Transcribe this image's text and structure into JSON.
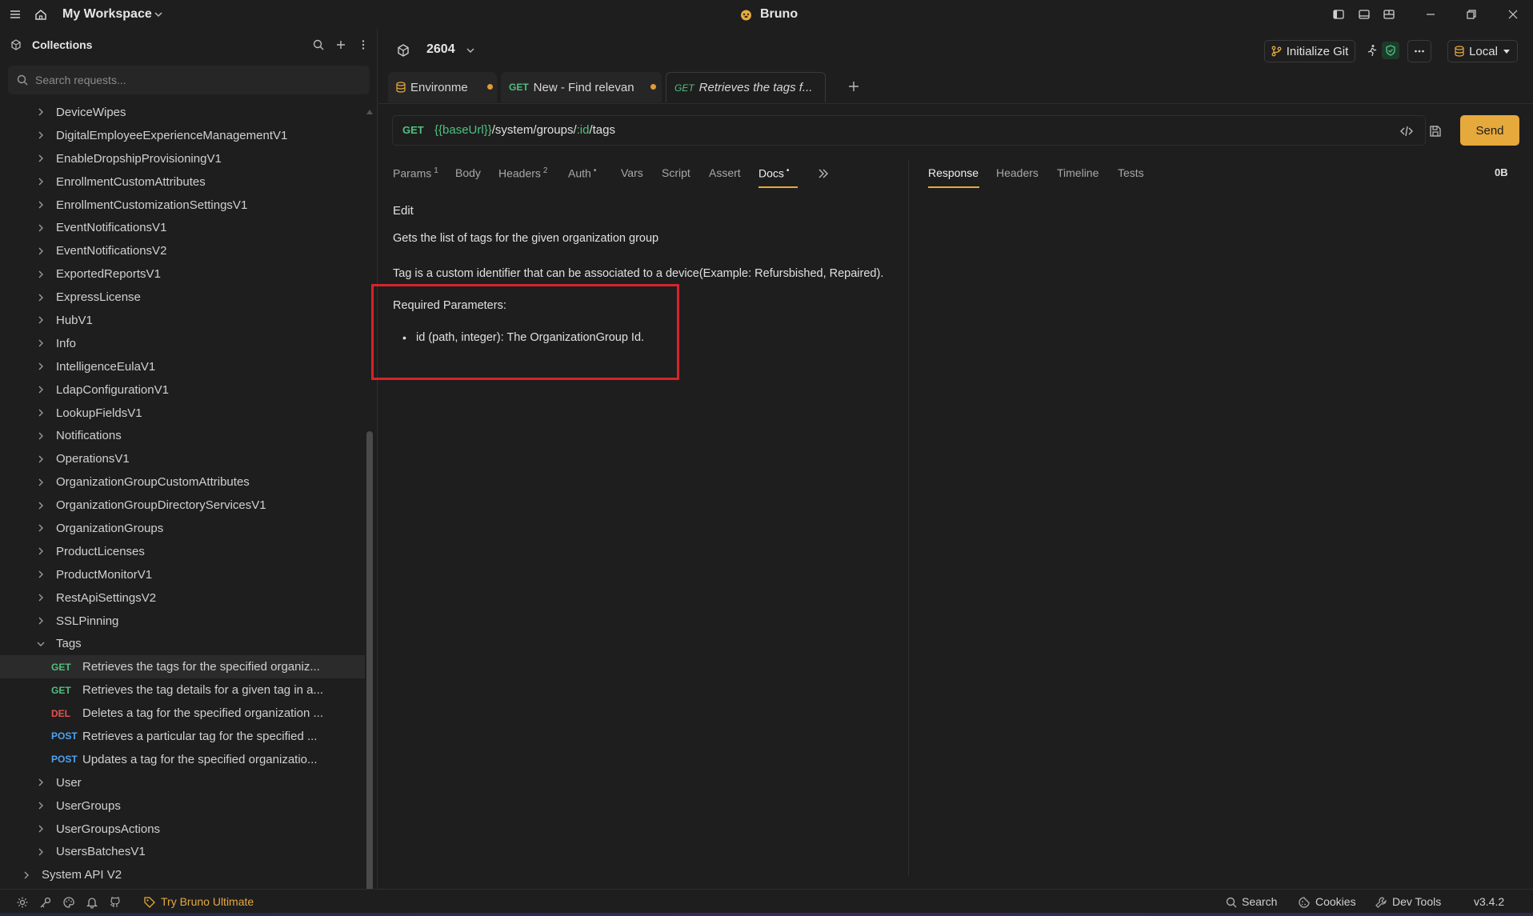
{
  "titlebar": {
    "workspace": "My Workspace",
    "app_title": "Bruno"
  },
  "sidebar": {
    "title": "Collections",
    "search_placeholder": "Search requests...",
    "folders_top": [
      "DeviceWipes",
      "DigitalEmployeeExperienceManagementV1",
      "EnableDropshipProvisioningV1",
      "EnrollmentCustomAttributes",
      "EnrollmentCustomizationSettingsV1",
      "EventNotificationsV1",
      "EventNotificationsV2",
      "ExportedReportsV1",
      "ExpressLicense",
      "HubV1",
      "Info",
      "IntelligenceEulaV1",
      "LdapConfigurationV1",
      "LookupFieldsV1",
      "Notifications",
      "OperationsV1",
      "OrganizationGroupCustomAttributes",
      "OrganizationGroupDirectoryServicesV1",
      "OrganizationGroups",
      "ProductLicenses",
      "ProductMonitorV1",
      "RestApiSettingsV2",
      "SSLPinning"
    ],
    "open_folder": "Tags",
    "requests": [
      {
        "method": "GET",
        "label": "Retrieves the tags for the specified organiz..."
      },
      {
        "method": "GET",
        "label": "Retrieves the tag details for a given tag in a..."
      },
      {
        "method": "DEL",
        "label": "Deletes a tag for the specified organization ..."
      },
      {
        "method": "POST",
        "label": "Retrieves a particular tag for the specified ..."
      },
      {
        "method": "POST",
        "label": "Updates a tag for the specified organizatio..."
      }
    ],
    "folders_bottom": [
      "User",
      "UserGroups",
      "UserGroupsActions",
      "UsersBatchesV1"
    ],
    "root_collection": "System API V2"
  },
  "header": {
    "collection": "2604",
    "init_git": "Initialize Git",
    "environment": "Local"
  },
  "tabs": [
    {
      "label": "Environme"
    },
    {
      "method": "GET",
      "label": "New - Find relevan"
    },
    {
      "method": "GET",
      "label": "Retrieves the tags f..."
    }
  ],
  "request": {
    "method": "GET",
    "url_var": "{{baseUrl}}",
    "url_path1": "/system/groups/",
    "url_param": ":id",
    "url_path2": "/tags",
    "send": "Send"
  },
  "request_tabs": {
    "params": "Params",
    "params_count": "1",
    "body": "Body",
    "headers": "Headers",
    "headers_count": "2",
    "auth": "Auth",
    "auth_mark": "•",
    "vars": "Vars",
    "script": "Script",
    "assert": "Assert",
    "docs": "Docs",
    "docs_mark": "•"
  },
  "response_tabs": {
    "response": "Response",
    "headers": "Headers",
    "timeline": "Timeline",
    "tests": "Tests",
    "size": "0B"
  },
  "docs": {
    "edit": "Edit",
    "line1": "Gets the list of tags for the given organization group",
    "line2": "Tag is a custom identifier that can be associated to a device(Example: Refursbished, Repaired).",
    "required": "Required Parameters:",
    "param": "id (path, integer): The OrganizationGroup Id."
  },
  "statusbar": {
    "ultimate": "Try Bruno Ultimate",
    "search": "Search",
    "cookies": "Cookies",
    "devtools": "Dev Tools",
    "version": "v3.4.2"
  },
  "colors": {
    "accent": "#e6a93c",
    "get": "#4ec17f",
    "delete": "#e5524c",
    "post": "#4ea3f2",
    "highlight": "#d8232a"
  }
}
